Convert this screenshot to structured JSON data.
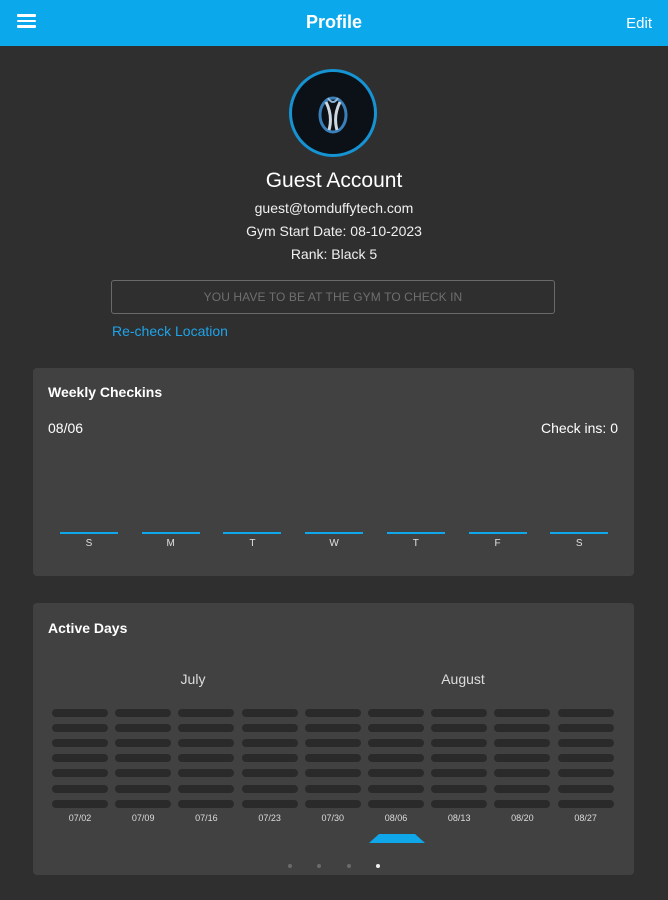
{
  "header": {
    "title": "Profile",
    "edit_label": "Edit",
    "menu_icon": "hamburger-menu-icon"
  },
  "profile": {
    "name": "Guest Account",
    "email": "guest@tomduffytech.com",
    "gym_start": "Gym Start Date: 08-10-2023",
    "rank": "Rank: Black 5"
  },
  "checkin": {
    "button_label": "YOU HAVE TO BE AT THE GYM TO CHECK IN",
    "recheck_label": "Re-check Location"
  },
  "weekly": {
    "title": "Weekly Checkins",
    "week_label": "08/06",
    "count_label": "Check ins: 0",
    "days": [
      "S",
      "M",
      "T",
      "W",
      "T",
      "F",
      "S"
    ]
  },
  "active": {
    "title": "Active Days",
    "months": [
      "July",
      "August"
    ],
    "weeks": [
      "07/02",
      "07/09",
      "07/16",
      "07/23",
      "07/30",
      "08/06",
      "08/13",
      "08/20",
      "08/27"
    ],
    "selected_week": "08/06",
    "pages": 4,
    "current_page": 4
  },
  "colors": {
    "accent": "#0ba8ec",
    "background": "#2f2f2f",
    "card": "#414141"
  }
}
